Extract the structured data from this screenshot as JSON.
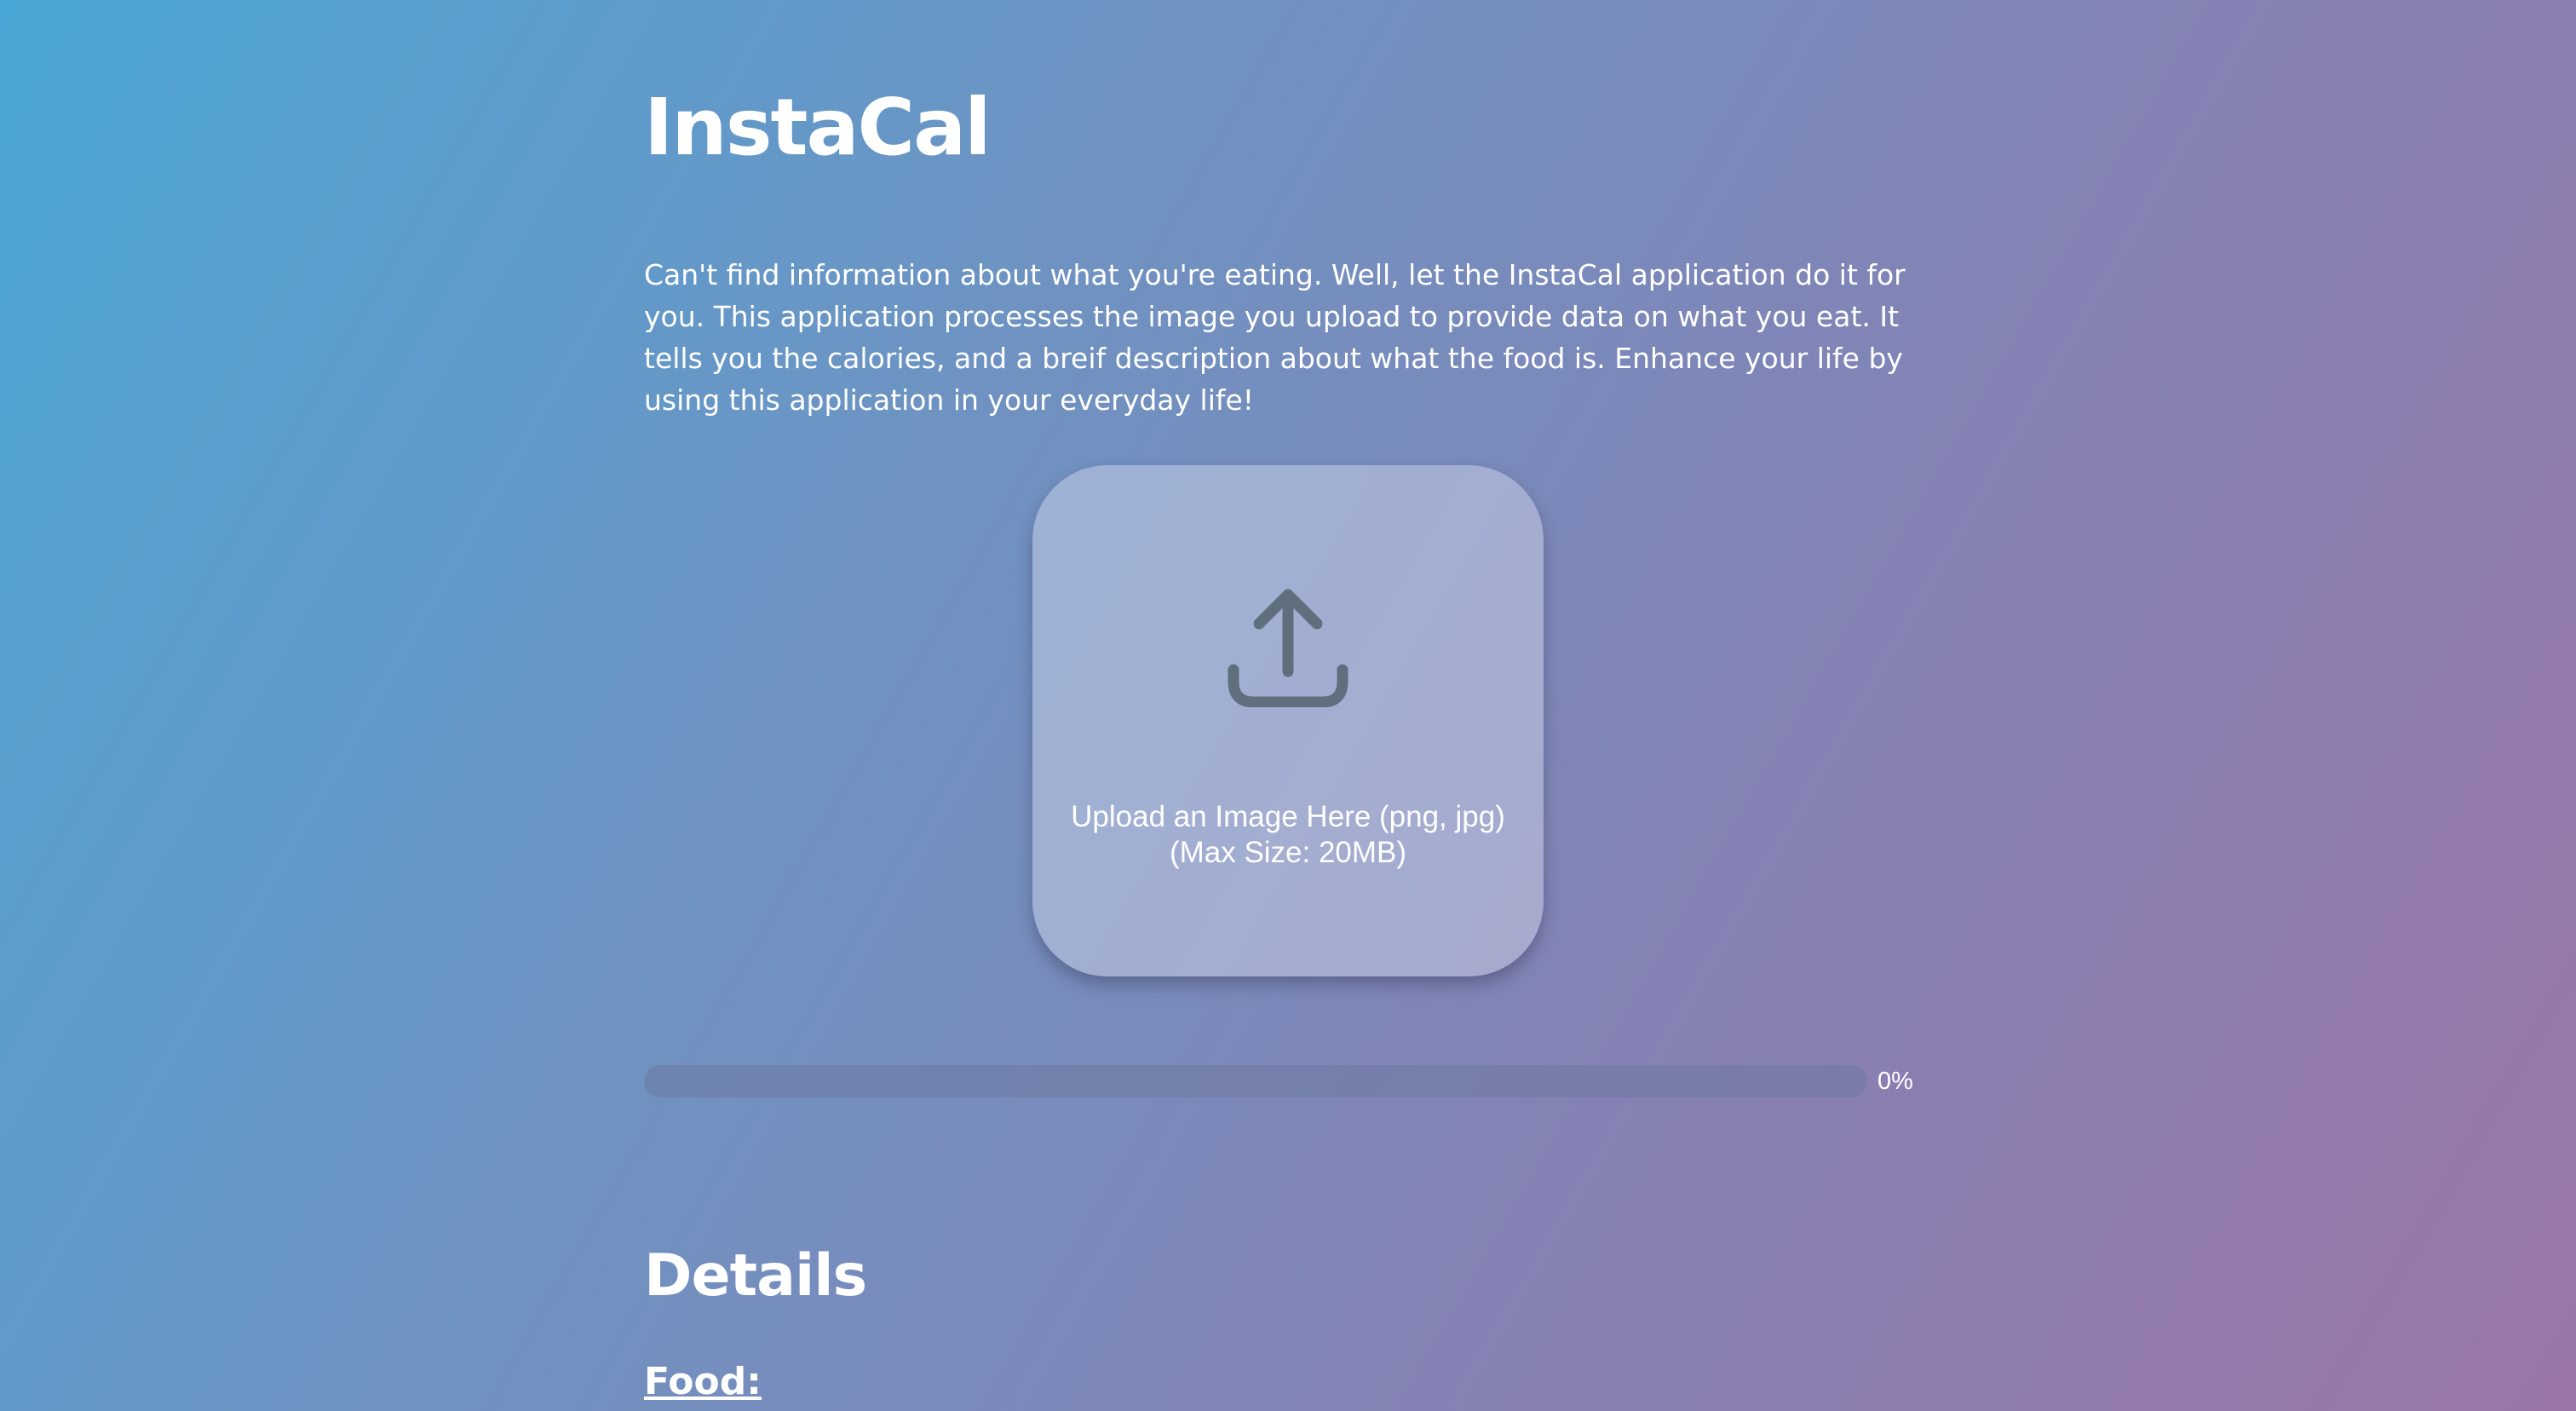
{
  "app": {
    "title": "InstaCal",
    "intro": "Can't find information about what you're eating. Well, let the InstaCal application do it for you. This application processes the image you upload to provide data on what you eat. It tells you the calories, and a breif description about what the food is. Enhance your life by using this application in your everyday life!"
  },
  "upload": {
    "icon": "upload-icon",
    "label_line1": "Upload an Image Here (png, jpg)",
    "label_line2": "(Max Size: 20MB)"
  },
  "progress": {
    "value": 0,
    "label": "0%"
  },
  "details": {
    "heading": "Details",
    "food_label": "Food:"
  },
  "colors": {
    "gradient_start": "#4aa6d6",
    "gradient_end": "#9a76a8",
    "icon": "#5f6f7e",
    "text": "#ffffff"
  }
}
